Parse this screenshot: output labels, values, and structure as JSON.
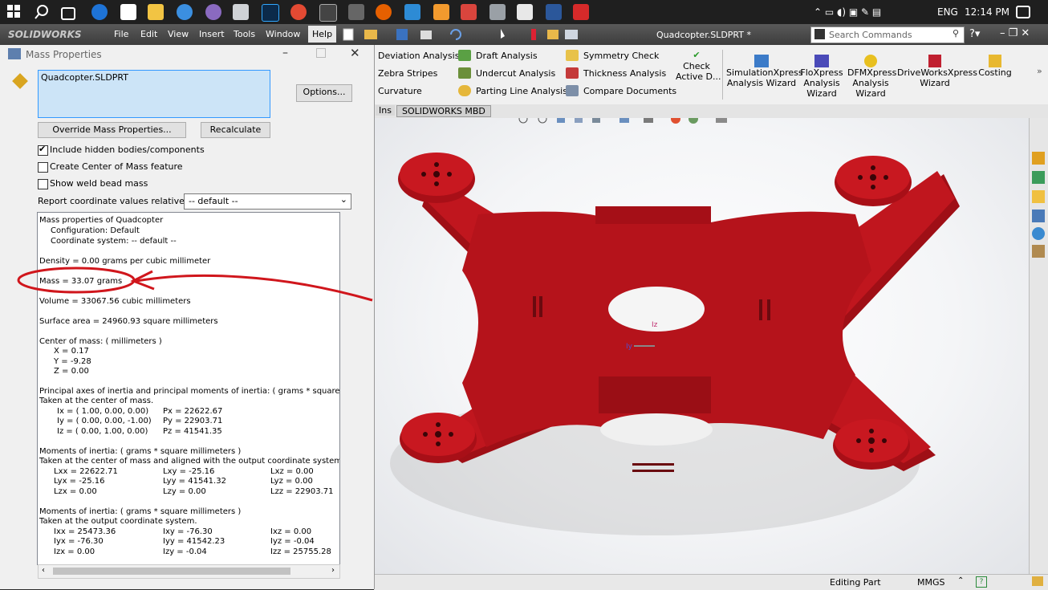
{
  "taskbar": {
    "time": "12:14 PM",
    "lang": "ENG"
  },
  "menu": {
    "brand": "SOLIDWORKS",
    "items": [
      "File",
      "Edit",
      "View",
      "Insert",
      "Tools",
      "Window",
      "Help"
    ],
    "doc_title": "Quadcopter.SLDPRT *",
    "search_placeholder": "Search Commands"
  },
  "ribbon": {
    "col1": [
      "Deviation Analysis",
      "Zebra Stripes",
      "Curvature"
    ],
    "col2": [
      "Draft Analysis",
      "Undercut Analysis",
      "Parting Line Analysis"
    ],
    "col3": [
      "Symmetry Check",
      "Thickness Analysis",
      "Compare Documents"
    ],
    "check_active": [
      "Check",
      "Active D..."
    ],
    "big": [
      {
        "lines": [
          "SimulationXpress",
          "Analysis Wizard"
        ]
      },
      {
        "lines": [
          "FloXpress",
          "Analysis",
          "Wizard"
        ]
      },
      {
        "lines": [
          "DFMXpress",
          "Analysis",
          "Wizard"
        ]
      },
      {
        "lines": [
          "DriveWorksXpress",
          "Wizard"
        ]
      },
      {
        "lines": [
          "Costing"
        ]
      }
    ],
    "tabs": [
      "Ins",
      "SOLIDWORKS MBD"
    ]
  },
  "status": {
    "editing": "Editing Part",
    "units": "MMGS"
  },
  "viewport": {
    "axis_z": "Iz",
    "axis_y": "Iy"
  },
  "dialog": {
    "title": "Mass Properties",
    "file": "Quadcopter.SLDPRT",
    "options_btn": "Options...",
    "override_btn": "Override Mass Properties...",
    "recalc_btn": "Recalculate",
    "chk_hidden": "Include hidden bodies/components",
    "chk_com": "Create Center of Mass feature",
    "chk_weld": "Show weld bead mass",
    "report_label": "Report coordinate values relative to:",
    "report_value": "-- default --",
    "results": {
      "l1": "Mass properties of Quadcopter",
      "l2": "Configuration: Default",
      "l3": "Coordinate system: -- default --",
      "density": "Density = 0.00 grams per cubic millimeter",
      "mass": "Mass = 33.07 grams",
      "volume": "Volume = 33067.56 cubic millimeters",
      "area": "Surface area = 24960.93  square millimeters",
      "com_title": "Center of mass: ( millimeters )",
      "com_x": "X = 0.17",
      "com_y": "Y = -9.28",
      "com_z": "Z = 0.00",
      "pa_title": "Principal axes of inertia and principal moments of inertia: ( grams *  square millimeters )",
      "pa_sub": "Taken at the center of mass.",
      "ix": "Ix = ( 1.00,  0.00,  0.00)",
      "iy": "Iy = ( 0.00,  0.00, -1.00)",
      "iz": "Iz = ( 0.00,  1.00,  0.00)",
      "px": "Px = 22622.67",
      "py": "Py = 22903.71",
      "pz": "Pz = 41541.35",
      "m1_title": "Moments of inertia: ( grams *  square millimeters )",
      "m1_sub": "Taken at the center of mass and aligned with the output coordinate system.",
      "m1": [
        [
          "Lxx = 22622.71",
          "Lxy = -25.16",
          "Lxz = 0.00"
        ],
        [
          "Lyx = -25.16",
          "Lyy = 41541.32",
          "Lyz = 0.00"
        ],
        [
          "Lzx = 0.00",
          "Lzy = 0.00",
          "Lzz = 22903.71"
        ]
      ],
      "m2_title": "Moments of inertia: ( grams *  square millimeters )",
      "m2_sub": "Taken at the output coordinate system.",
      "m2": [
        [
          "Ixx = 25473.36",
          "Ixy = -76.30",
          "Ixz = 0.00"
        ],
        [
          "Iyx = -76.30",
          "Iyy = 41542.23",
          "Iyz = -0.04"
        ],
        [
          "Izx = 0.00",
          "Izy = -0.04",
          "Izz = 25755.28"
        ]
      ]
    }
  },
  "colors": {
    "model_red": "#b0121a",
    "annotation_red": "#d0161c",
    "sw_blue": "#cce4f7"
  }
}
